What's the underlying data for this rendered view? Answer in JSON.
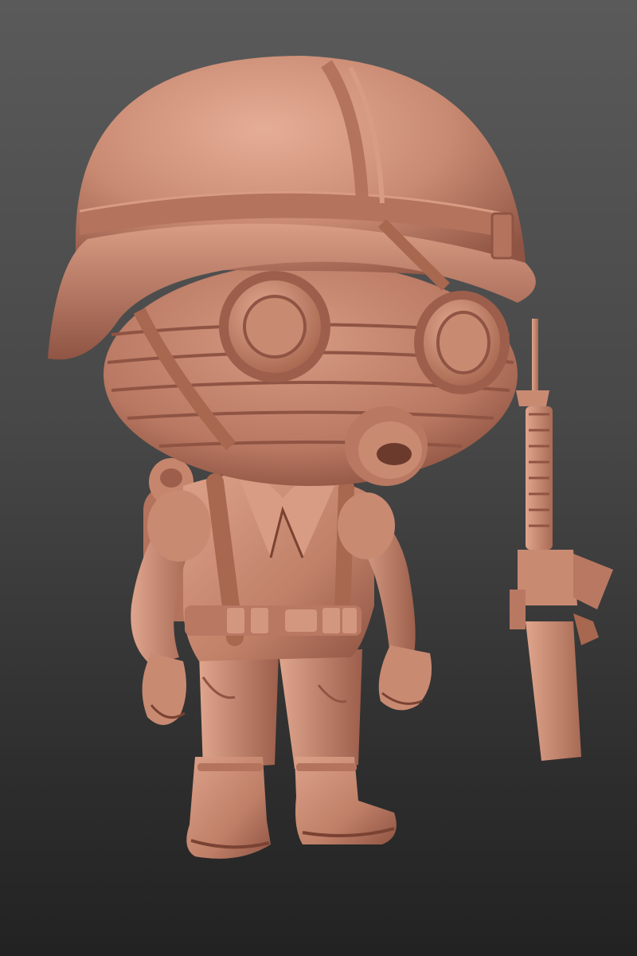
{
  "scene": {
    "subject": "clay-render-chibi-soldier",
    "colors": {
      "clay_base": "#c98a72",
      "clay_light": "#e3a992",
      "clay_mid": "#b97862",
      "clay_dark": "#8f5443",
      "clay_deep": "#6b3a2c",
      "background_top": "#5a5a5a",
      "background_bottom": "#222222"
    }
  }
}
